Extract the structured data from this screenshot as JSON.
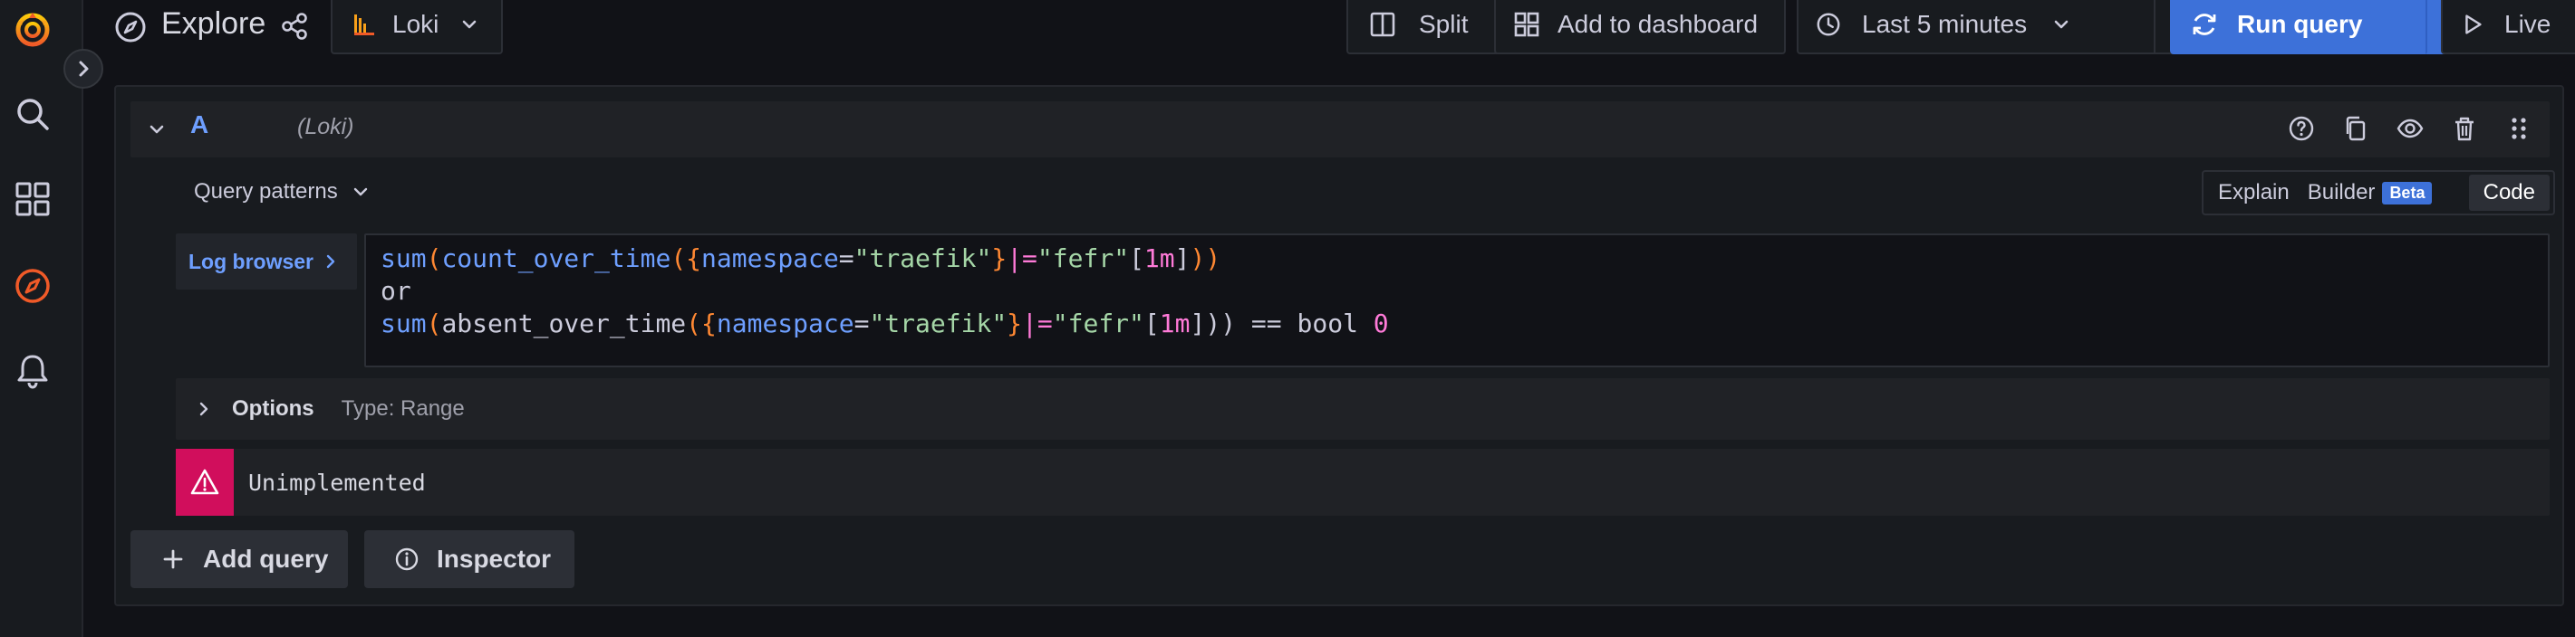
{
  "header": {
    "title": "Explore",
    "datasource": "Loki",
    "split_label": "Split",
    "add_dashboard_label": "Add to dashboard",
    "time_range": "Last 5 minutes",
    "run_query_label": "Run query",
    "live_label": "Live"
  },
  "query": {
    "letter": "A",
    "datasource_label": "(Loki)",
    "patterns_label": "Query patterns",
    "modes": [
      "Explain",
      "Builder",
      "Code"
    ],
    "beta_badge": "Beta",
    "active_mode": "Code",
    "log_browser_label": "Log browser",
    "code_tokens": {
      "sum": "sum",
      "count_over_time": "count_over_time",
      "absent_over_time": "absent_over_time",
      "label": "namespace",
      "value": "\"traefik\"",
      "filter_op": "|=",
      "filter_value": "\"fefr\"",
      "range": "1m",
      "or": "or",
      "cmp": "== bool",
      "zero": "0"
    },
    "options_label": "Options",
    "options_type": "Type: Range",
    "error_text": "Unimplemented"
  },
  "actions": {
    "add_query_label": "Add query",
    "inspector_label": "Inspector"
  },
  "colors": {
    "primary": "#3d71d9",
    "error": "#d10e5c",
    "brand_orange": "#f05a28"
  }
}
